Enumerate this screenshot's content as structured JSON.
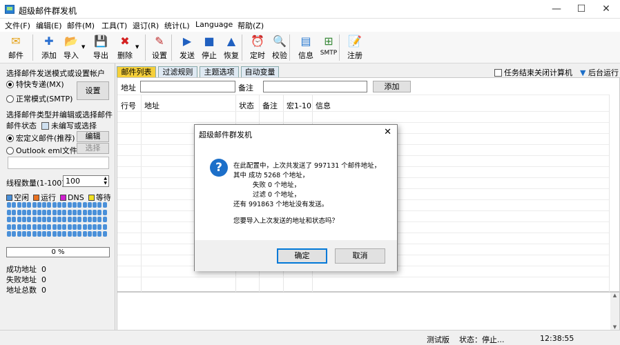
{
  "window": {
    "title": "超级邮件群发机",
    "min": "—",
    "max": "☐",
    "close": "✕"
  },
  "menu": [
    "文件(F)",
    "编辑(E)",
    "邮件(M)",
    "工具(T)",
    "退订(R)",
    "统计(L)",
    "Language",
    "帮助(Z)"
  ],
  "toolbar": [
    {
      "label": "邮件",
      "icon": "mail-icon",
      "glyph": "✉",
      "color": "#e4a21a"
    },
    {
      "label": "添加",
      "icon": "add-icon",
      "glyph": "✚",
      "color": "#2a6fd0"
    },
    {
      "label": "导入",
      "icon": "import-icon",
      "glyph": "📂",
      "color": "#3a9a3a"
    },
    {
      "label": "导出",
      "icon": "export-icon",
      "glyph": "💾",
      "color": "#2050a0"
    },
    {
      "label": "删除",
      "icon": "delete-icon",
      "glyph": "✖",
      "color": "#d42020"
    },
    {
      "label": "设置",
      "icon": "settings-icon",
      "glyph": "✎",
      "color": "#c03030"
    },
    {
      "label": "发送",
      "icon": "send-icon",
      "glyph": "▶",
      "color": "#2060c0"
    },
    {
      "label": "停止",
      "icon": "stop-icon",
      "glyph": "■",
      "color": "#2060c0"
    },
    {
      "label": "恢复",
      "icon": "resume-icon",
      "glyph": "▲",
      "color": "#2060c0"
    },
    {
      "label": "定时",
      "icon": "timer-icon",
      "glyph": "⏰",
      "color": "#d03030"
    },
    {
      "label": "校验",
      "icon": "verify-icon",
      "glyph": "🔍",
      "color": "#2a7ad0"
    },
    {
      "label": "信息",
      "icon": "info-icon",
      "glyph": "▤",
      "color": "#2a7ad0"
    },
    {
      "label": "SMTP",
      "icon": "smtp-icon",
      "glyph": "⊞",
      "color": "#3a8a3a"
    },
    {
      "label": "注册",
      "icon": "register-icon",
      "glyph": "📝",
      "color": "#c08020"
    }
  ],
  "left": {
    "send_mode_title": "选择邮件发送模式或设置帐户",
    "mode_mx": "特快专递(MX)",
    "mode_smtp": "正常模式(SMTP)",
    "setup_button": "设置",
    "mail_type_title": "选择邮件类型并编辑或选择邮件",
    "mail_status_label": "邮件状态",
    "unedited_label": "未编写或选择",
    "macro_mail": "宏定义邮件(推荐)",
    "edit_button": "编辑",
    "outlook_eml": "Outlook eml文件",
    "select_button": "选择",
    "threads_label": "线程数量(1-100)",
    "threads_value": "100",
    "legend": [
      {
        "label": "空闲",
        "color": "#4a90d9"
      },
      {
        "label": "运行",
        "color": "#e87020"
      },
      {
        "label": "DNS",
        "color": "#d020d0"
      },
      {
        "label": "等待",
        "color": "#f0e020"
      }
    ],
    "progress": "0 %",
    "success_label": "成功地址",
    "success_value": "0",
    "fail_label": "失败地址",
    "fail_value": "0",
    "total_label": "地址总数",
    "total_value": "0"
  },
  "tabs": [
    "邮件列表",
    "过滤规则",
    "主题选项",
    "自动变量"
  ],
  "shutdown_label": "任务结束关闭计算机",
  "background_label": "后台运行",
  "filter": {
    "address_label": "地址",
    "note_label": "备注",
    "add_button": "添加"
  },
  "columns": [
    "行号",
    "地址",
    "状态",
    "备注",
    "宏1-10",
    "信息"
  ],
  "status": {
    "edition": "测试版",
    "state": "状态：停止...",
    "time": "12:38:55"
  },
  "dialog": {
    "title": "超级邮件群发机",
    "close": "✕",
    "lines": [
      "在此配置中，上次共发送了 997131 个邮件地址，",
      "其中    成功 5268 个地址，",
      "          失败 0 个地址，",
      "          过滤 0 个地址，",
      "还有 991863 个地址没有发送。",
      "",
      "您要导入上次发送的地址和状态吗？"
    ],
    "ok": "确定",
    "cancel": "取消"
  }
}
